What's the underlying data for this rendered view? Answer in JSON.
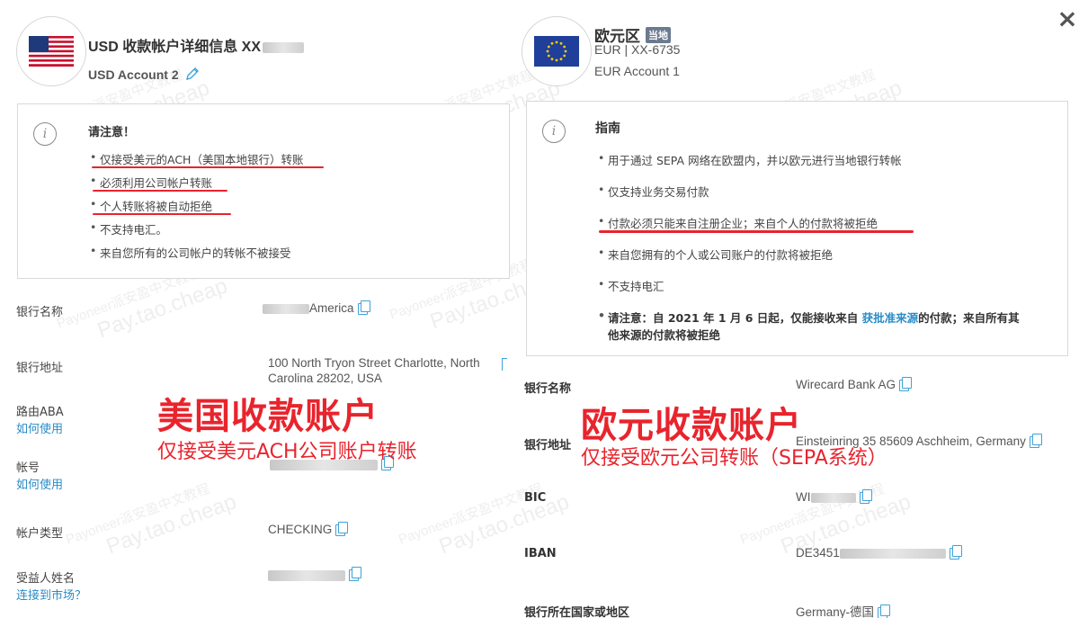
{
  "close_label": "×",
  "usd": {
    "title": "USD 收款帐户详细信息 XX",
    "name": "USD Account 2",
    "notice": {
      "title": "请注意！",
      "bullets": [
        "仅接受美元的ACH（美国本地银行）转账",
        "必须利用公司帐户转账",
        "个人转账将被自动拒绝",
        "不支持电汇。",
        "来自您所有的公司帐户的转帐不被接受"
      ]
    },
    "fields": {
      "bank_name_label": "银行名称",
      "bank_name_value": "America",
      "bank_address_label": "银行地址",
      "bank_address_line1": "100 North Tryon Street Charlotte, North",
      "bank_address_line2": "Carolina 28202, USA",
      "routing_label": "路由ABA",
      "routing_help": "如何使用",
      "account_no_label": "帐号",
      "account_no_help": "如何使用",
      "account_type_label": "帐户类型",
      "account_type_value": "CHECKING",
      "beneficiary_label": "受益人姓名",
      "beneficiary_help": "连接到市场？"
    }
  },
  "eur": {
    "title": "欧元区",
    "badge": "当地",
    "account_number": "EUR | XX-6735",
    "name": "EUR Account 1",
    "guide": {
      "title": "指南",
      "bullets": [
        "用于通过 SEPA 网络在欧盟内，并以欧元进行当地银行转帐",
        "仅支持业务交易付款",
        "付款必须只能来自注册企业；来自个人的付款将被拒绝",
        "来自您拥有的个人或公司账户的付款将被拒绝",
        "不支持电汇"
      ],
      "note_prefix": "请注意：自 2021 年 1 月 6 日起，仅能接收来自 ",
      "note_link": "获批准来源",
      "note_suffix": "的付款；来自所有其",
      "note_line2": "他来源的付款将被拒绝"
    },
    "fields": {
      "bank_name_label": "银行名称",
      "bank_name_value": "Wirecard Bank AG",
      "bank_address_label": "银行地址",
      "bank_address_value": "Einsteinring 35 85609 Aschheim, Germany",
      "bic_label": "BIC",
      "bic_value": "WI",
      "iban_label": "IBAN",
      "iban_value": "DE3451",
      "country_label": "银行所在国家或地区",
      "country_value": "Germany-德国"
    }
  },
  "annotations": {
    "usd_title": "美国收款账户",
    "usd_sub": "仅接受美元ACH公司账户转账",
    "eur_title": "欧元收款账户",
    "eur_sub": "仅接受欧元公司转账（SEPA系统）"
  },
  "watermark": {
    "line1": "Payoneer派安盈中文教程",
    "line2": "Pay.tao.cheap"
  },
  "colors": {
    "annotation_red": "#e8242d",
    "link_blue": "#2a8cc7",
    "copy_icon_blue": "#3fa2d8",
    "badge_gray": "#6b7a8f"
  }
}
